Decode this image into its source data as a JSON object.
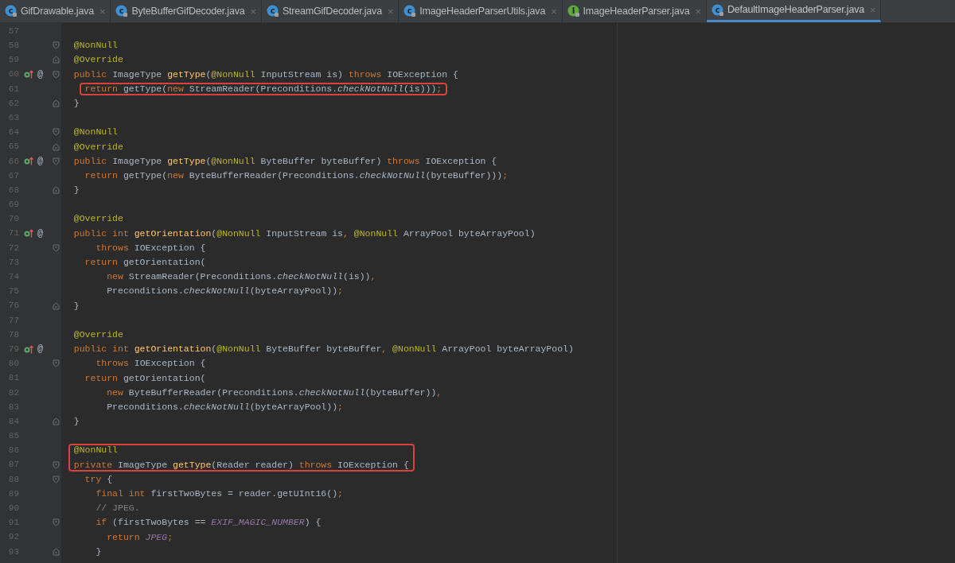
{
  "tabs": [
    {
      "label": "GifDrawable.java",
      "kind": "class",
      "icon_letter": "c",
      "close": "×",
      "selected": false
    },
    {
      "label": "ByteBufferGifDecoder.java",
      "kind": "class",
      "icon_letter": "c",
      "close": "×",
      "selected": false
    },
    {
      "label": "StreamGifDecoder.java",
      "kind": "class",
      "icon_letter": "c",
      "close": "×",
      "selected": false
    },
    {
      "label": "ImageHeaderParserUtils.java",
      "kind": "class",
      "icon_letter": "c",
      "close": "×",
      "selected": false
    },
    {
      "label": "ImageHeaderParser.java",
      "kind": "interface",
      "icon_letter": "I",
      "close": "×",
      "selected": false
    },
    {
      "label": "DefaultImageHeaderParser.java",
      "kind": "class",
      "icon_letter": "c",
      "close": "×",
      "selected": true
    }
  ],
  "editor": {
    "lines": [
      {
        "number": "57",
        "override": false,
        "fold_start": false,
        "fold_end": false,
        "boxed": false
      },
      {
        "number": "58",
        "override": false,
        "fold_start": true,
        "fold_end": false,
        "boxed": false,
        "tokens": [
          {
            "kind": "annotation",
            "text": "  @NonNull"
          }
        ]
      },
      {
        "number": "59",
        "override": false,
        "fold_start": false,
        "fold_end": true,
        "boxed": false,
        "tokens": [
          {
            "kind": "annotation",
            "text": "  @Override"
          }
        ]
      },
      {
        "number": "60",
        "override": true,
        "gutter_symbol": "@",
        "fold_start": true,
        "fold_end": false,
        "boxed": false,
        "tokens": [
          {
            "kind": "keyword",
            "text": "  public "
          },
          {
            "kind": "plain",
            "text": "ImageType "
          },
          {
            "kind": "function",
            "text": "getType"
          },
          {
            "kind": "plain",
            "text": "("
          },
          {
            "kind": "annotation",
            "text": "@NonNull"
          },
          {
            "kind": "plain",
            "text": " InputStream is) "
          },
          {
            "kind": "keyword",
            "text": "throws"
          },
          {
            "kind": "plain",
            "text": " IOException {"
          }
        ]
      },
      {
        "number": "61",
        "override": false,
        "fold_start": false,
        "fold_end": false,
        "boxed": true,
        "tokens": [
          {
            "kind": "keyword",
            "text": "    return"
          },
          {
            "kind": "plain",
            "text": " getType("
          },
          {
            "kind": "keyword",
            "text": "new"
          },
          {
            "kind": "plain",
            "text": " StreamReader(Preconditions."
          },
          {
            "kind": "static",
            "text": "checkNotNull"
          },
          {
            "kind": "plain",
            "text": "(is)))"
          },
          {
            "kind": "keyword",
            "text": ";"
          }
        ]
      },
      {
        "number": "62",
        "override": false,
        "fold_start": false,
        "fold_end": true,
        "boxed": false,
        "tokens": [
          {
            "kind": "plain",
            "text": "  }"
          }
        ]
      },
      {
        "number": "63",
        "override": false,
        "fold_start": false,
        "fold_end": false,
        "boxed": false
      },
      {
        "number": "64",
        "override": false,
        "fold_start": true,
        "fold_end": false,
        "boxed": false,
        "tokens": [
          {
            "kind": "annotation",
            "text": "  @NonNull"
          }
        ]
      },
      {
        "number": "65",
        "override": false,
        "fold_start": false,
        "fold_end": true,
        "boxed": false,
        "tokens": [
          {
            "kind": "annotation",
            "text": "  @Override"
          }
        ]
      },
      {
        "number": "66",
        "override": true,
        "gutter_symbol": "@",
        "fold_start": true,
        "fold_end": false,
        "boxed": false,
        "tokens": [
          {
            "kind": "keyword",
            "text": "  public "
          },
          {
            "kind": "plain",
            "text": "ImageType "
          },
          {
            "kind": "function",
            "text": "getType"
          },
          {
            "kind": "plain",
            "text": "("
          },
          {
            "kind": "annotation",
            "text": "@NonNull"
          },
          {
            "kind": "plain",
            "text": " ByteBuffer byteBuffer) "
          },
          {
            "kind": "keyword",
            "text": "throws"
          },
          {
            "kind": "plain",
            "text": " IOException {"
          }
        ]
      },
      {
        "number": "67",
        "override": false,
        "fold_start": false,
        "fold_end": false,
        "boxed": false,
        "tokens": [
          {
            "kind": "keyword",
            "text": "    return"
          },
          {
            "kind": "plain",
            "text": " getType("
          },
          {
            "kind": "keyword",
            "text": "new"
          },
          {
            "kind": "plain",
            "text": " ByteBufferReader(Preconditions."
          },
          {
            "kind": "static",
            "text": "checkNotNull"
          },
          {
            "kind": "plain",
            "text": "(byteBuffer)))"
          },
          {
            "kind": "keyword",
            "text": ";"
          }
        ]
      },
      {
        "number": "68",
        "override": false,
        "fold_start": false,
        "fold_end": true,
        "boxed": false,
        "tokens": [
          {
            "kind": "plain",
            "text": "  }"
          }
        ]
      },
      {
        "number": "69",
        "override": false,
        "fold_start": false,
        "fold_end": false,
        "boxed": false
      },
      {
        "number": "70",
        "override": false,
        "fold_start": false,
        "fold_end": false,
        "boxed": false,
        "tokens": [
          {
            "kind": "annotation",
            "text": "  @Override"
          }
        ]
      },
      {
        "number": "71",
        "override": true,
        "gutter_symbol": "@",
        "fold_start": false,
        "fold_end": false,
        "boxed": false,
        "tokens": [
          {
            "kind": "keyword",
            "text": "  public int "
          },
          {
            "kind": "function",
            "text": "getOrientation"
          },
          {
            "kind": "plain",
            "text": "("
          },
          {
            "kind": "annotation",
            "text": "@NonNull"
          },
          {
            "kind": "plain",
            "text": " InputStream is"
          },
          {
            "kind": "keyword",
            "text": ","
          },
          {
            "kind": "annotation",
            "text": " @NonNull"
          },
          {
            "kind": "plain",
            "text": " ArrayPool byteArrayPool)"
          }
        ]
      },
      {
        "number": "72",
        "override": false,
        "fold_start": true,
        "fold_end": false,
        "boxed": false,
        "tokens": [
          {
            "kind": "keyword",
            "text": "      throws"
          },
          {
            "kind": "plain",
            "text": " IOException {"
          }
        ]
      },
      {
        "number": "73",
        "override": false,
        "fold_start": false,
        "fold_end": false,
        "boxed": false,
        "tokens": [
          {
            "kind": "keyword",
            "text": "    return"
          },
          {
            "kind": "plain",
            "text": " getOrientation("
          }
        ]
      },
      {
        "number": "74",
        "override": false,
        "fold_start": false,
        "fold_end": false,
        "boxed": false,
        "tokens": [
          {
            "kind": "keyword",
            "text": "        new"
          },
          {
            "kind": "plain",
            "text": " StreamReader(Preconditions."
          },
          {
            "kind": "static",
            "text": "checkNotNull"
          },
          {
            "kind": "plain",
            "text": "(is))"
          },
          {
            "kind": "keyword",
            "text": ","
          }
        ]
      },
      {
        "number": "75",
        "override": false,
        "fold_start": false,
        "fold_end": false,
        "boxed": false,
        "tokens": [
          {
            "kind": "plain",
            "text": "        Preconditions."
          },
          {
            "kind": "static",
            "text": "checkNotNull"
          },
          {
            "kind": "plain",
            "text": "(byteArrayPool))"
          },
          {
            "kind": "keyword",
            "text": ";"
          }
        ]
      },
      {
        "number": "76",
        "override": false,
        "fold_start": false,
        "fold_end": true,
        "boxed": false,
        "tokens": [
          {
            "kind": "plain",
            "text": "  }"
          }
        ]
      },
      {
        "number": "77",
        "override": false,
        "fold_start": false,
        "fold_end": false,
        "boxed": false
      },
      {
        "number": "78",
        "override": false,
        "fold_start": false,
        "fold_end": false,
        "boxed": false,
        "tokens": [
          {
            "kind": "annotation",
            "text": "  @Override"
          }
        ]
      },
      {
        "number": "79",
        "override": true,
        "gutter_symbol": "@",
        "fold_start": false,
        "fold_end": false,
        "boxed": false,
        "tokens": [
          {
            "kind": "keyword",
            "text": "  public int "
          },
          {
            "kind": "function",
            "text": "getOrientation"
          },
          {
            "kind": "plain",
            "text": "("
          },
          {
            "kind": "annotation",
            "text": "@NonNull"
          },
          {
            "kind": "plain",
            "text": " ByteBuffer byteBuffer"
          },
          {
            "kind": "keyword",
            "text": ","
          },
          {
            "kind": "annotation",
            "text": " @NonNull"
          },
          {
            "kind": "plain",
            "text": " ArrayPool byteArrayPool)"
          }
        ]
      },
      {
        "number": "80",
        "override": false,
        "fold_start": true,
        "fold_end": false,
        "boxed": false,
        "tokens": [
          {
            "kind": "keyword",
            "text": "      throws"
          },
          {
            "kind": "plain",
            "text": " IOException {"
          }
        ]
      },
      {
        "number": "81",
        "override": false,
        "fold_start": false,
        "fold_end": false,
        "boxed": false,
        "tokens": [
          {
            "kind": "keyword",
            "text": "    return"
          },
          {
            "kind": "plain",
            "text": " getOrientation("
          }
        ]
      },
      {
        "number": "82",
        "override": false,
        "fold_start": false,
        "fold_end": false,
        "boxed": false,
        "tokens": [
          {
            "kind": "keyword",
            "text": "        new"
          },
          {
            "kind": "plain",
            "text": " ByteBufferReader(Preconditions."
          },
          {
            "kind": "static",
            "text": "checkNotNull"
          },
          {
            "kind": "plain",
            "text": "(byteBuffer))"
          },
          {
            "kind": "keyword",
            "text": ","
          }
        ]
      },
      {
        "number": "83",
        "override": false,
        "fold_start": false,
        "fold_end": false,
        "boxed": false,
        "tokens": [
          {
            "kind": "plain",
            "text": "        Preconditions."
          },
          {
            "kind": "static",
            "text": "checkNotNull"
          },
          {
            "kind": "plain",
            "text": "(byteArrayPool))"
          },
          {
            "kind": "keyword",
            "text": ";"
          }
        ]
      },
      {
        "number": "84",
        "override": false,
        "fold_start": false,
        "fold_end": true,
        "boxed": false,
        "tokens": [
          {
            "kind": "plain",
            "text": "  }"
          }
        ]
      },
      {
        "number": "85",
        "override": false,
        "fold_start": false,
        "fold_end": false,
        "boxed": false
      },
      {
        "number": "86",
        "override": false,
        "fold_start": false,
        "fold_end": false,
        "boxed": true,
        "tokens": [
          {
            "kind": "annotation",
            "text": "  @NonNull"
          }
        ]
      },
      {
        "number": "87",
        "override": false,
        "fold_start": true,
        "fold_end": false,
        "boxed": true,
        "tokens": [
          {
            "kind": "keyword",
            "text": "  private "
          },
          {
            "kind": "plain",
            "text": "ImageType "
          },
          {
            "kind": "function",
            "text": "getType"
          },
          {
            "kind": "plain",
            "text": "(Reader reader) "
          },
          {
            "kind": "keyword",
            "text": "throws"
          },
          {
            "kind": "plain",
            "text": " IOException {"
          }
        ]
      },
      {
        "number": "88",
        "override": false,
        "fold_start": true,
        "fold_end": false,
        "boxed": false,
        "tokens": [
          {
            "kind": "keyword",
            "text": "    try"
          },
          {
            "kind": "plain",
            "text": " {"
          }
        ]
      },
      {
        "number": "89",
        "override": false,
        "fold_start": false,
        "fold_end": false,
        "boxed": false,
        "tokens": [
          {
            "kind": "keyword",
            "text": "      final int"
          },
          {
            "kind": "plain",
            "text": " firstTwoBytes = reader.getUInt16()"
          },
          {
            "kind": "keyword",
            "text": ";"
          }
        ]
      },
      {
        "number": "90",
        "override": false,
        "fold_start": false,
        "fold_end": false,
        "boxed": false,
        "tokens": [
          {
            "kind": "comment",
            "text": "      // JPEG."
          }
        ]
      },
      {
        "number": "91",
        "override": false,
        "fold_start": true,
        "fold_end": false,
        "boxed": false,
        "tokens": [
          {
            "kind": "keyword",
            "text": "      if"
          },
          {
            "kind": "plain",
            "text": " (firstTwoBytes == "
          },
          {
            "kind": "constant",
            "text": "EXIF_MAGIC_NUMBER"
          },
          {
            "kind": "plain",
            "text": ") {"
          }
        ]
      },
      {
        "number": "92",
        "override": false,
        "fold_start": false,
        "fold_end": false,
        "boxed": false,
        "tokens": [
          {
            "kind": "keyword",
            "text": "        return "
          },
          {
            "kind": "constant",
            "text": "JPEG"
          },
          {
            "kind": "keyword",
            "text": ";"
          }
        ]
      },
      {
        "number": "93",
        "override": false,
        "fold_start": false,
        "fold_end": true,
        "boxed": false,
        "tokens": [
          {
            "kind": "plain",
            "text": "      }"
          }
        ]
      }
    ]
  }
}
